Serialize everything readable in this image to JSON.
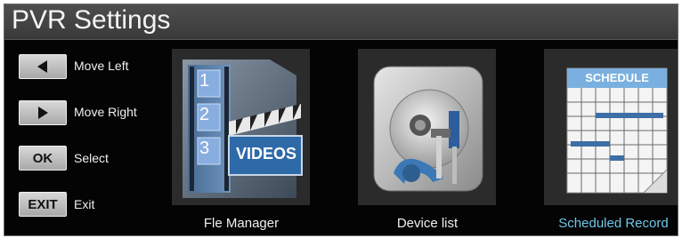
{
  "title": "PVR Settings",
  "legend": [
    {
      "key_icon": "triangle-left-icon",
      "key_text": "",
      "label": "Move Left"
    },
    {
      "key_icon": "triangle-right-icon",
      "key_text": "",
      "label": "Move Right"
    },
    {
      "key_icon": "",
      "key_text": "OK",
      "label": "Select"
    },
    {
      "key_icon": "",
      "key_text": "EXIT",
      "label": "Exit"
    }
  ],
  "menu": {
    "items": [
      {
        "label": "Fle Manager",
        "icon": "videos-folder-icon",
        "selected": false,
        "icon_numbers": [
          "1",
          "2",
          "3"
        ],
        "icon_text": "VIDEOS"
      },
      {
        "label": "Device list",
        "icon": "hard-drive-tools-icon",
        "selected": false
      },
      {
        "label": "Scheduled Record",
        "icon": "schedule-calendar-icon",
        "selected": true,
        "icon_text": "SCHEDULE"
      }
    ]
  },
  "colors": {
    "selected_label": "#6fc7e8",
    "titlebar": "#454545",
    "tile": "#2b2b2b"
  }
}
